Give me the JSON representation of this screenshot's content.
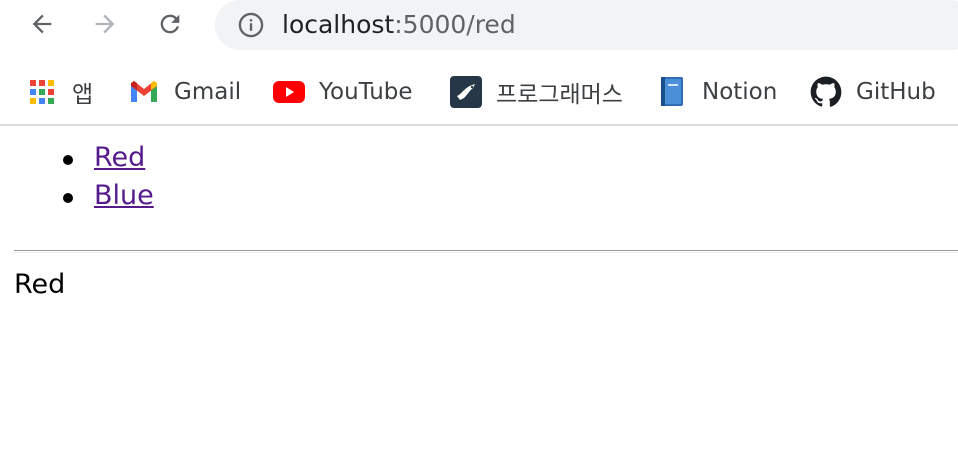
{
  "browser": {
    "url_host": "localhost",
    "url_path": ":5000/red",
    "bookmarks": [
      {
        "label": "앱",
        "icon": "apps-grid-icon"
      },
      {
        "label": "Gmail",
        "icon": "gmail-icon"
      },
      {
        "label": "YouTube",
        "icon": "youtube-icon"
      },
      {
        "label": "프로그래머스",
        "icon": "programmers-icon"
      },
      {
        "label": "Notion",
        "icon": "notion-book-icon"
      },
      {
        "label": "GitHub",
        "icon": "github-icon"
      }
    ]
  },
  "page": {
    "links": [
      {
        "label": "Red"
      },
      {
        "label": "Blue"
      }
    ],
    "body_text": "Red"
  },
  "colors": {
    "link_visited": "#551a8b",
    "omnibox_bg": "#f1f3f4",
    "youtube_red": "#ff0000"
  }
}
